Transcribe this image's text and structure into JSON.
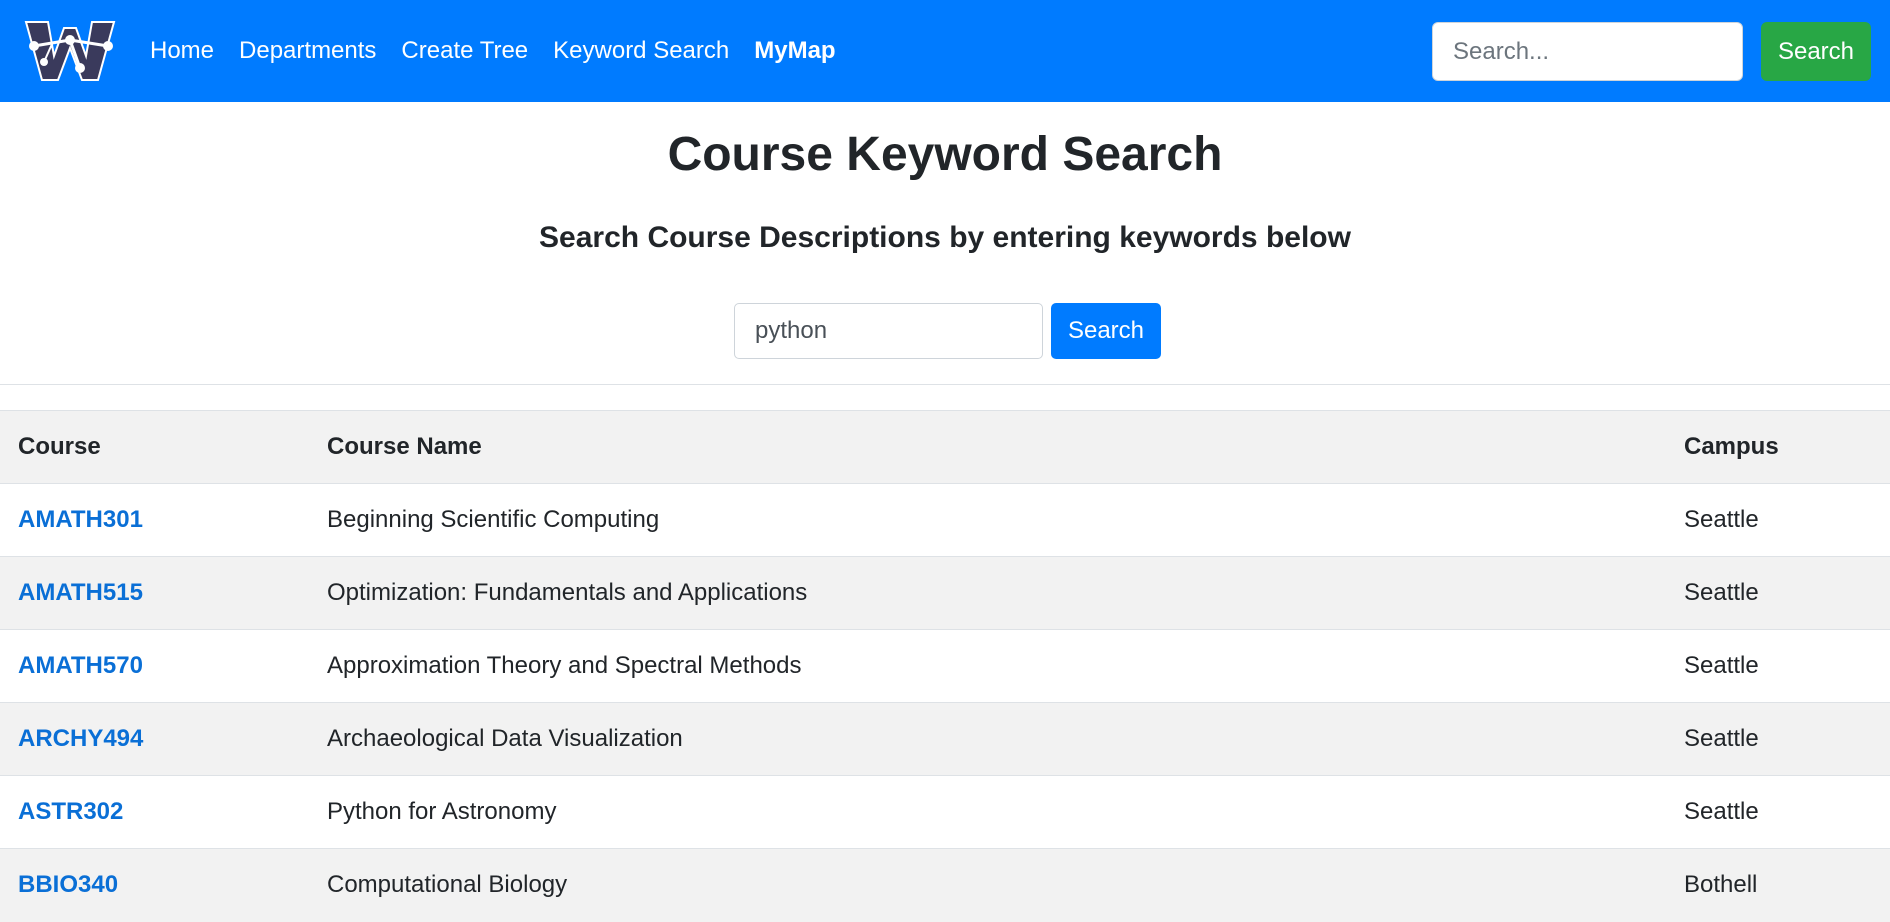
{
  "navbar": {
    "logo_icon": "uw-w-tree-logo",
    "links": [
      {
        "label": "Home",
        "active": false
      },
      {
        "label": "Departments",
        "active": false
      },
      {
        "label": "Create Tree",
        "active": false
      },
      {
        "label": "Keyword Search",
        "active": false
      },
      {
        "label": "MyMap",
        "active": true
      }
    ],
    "search": {
      "placeholder": "Search...",
      "value": "",
      "button_label": "Search"
    },
    "colors": {
      "background": "#007bff",
      "search_button": "#28a745"
    }
  },
  "main": {
    "title": "Course Keyword Search",
    "subtitle": "Search Course Descriptions by entering keywords below",
    "keyword_input": {
      "value": "python",
      "placeholder": ""
    },
    "search_button_label": "Search"
  },
  "table": {
    "headers": {
      "course": "Course",
      "name": "Course Name",
      "campus": "Campus"
    },
    "rows": [
      {
        "course": "AMATH301",
        "name": "Beginning Scientific Computing",
        "campus": "Seattle"
      },
      {
        "course": "AMATH515",
        "name": "Optimization: Fundamentals and Applications",
        "campus": "Seattle"
      },
      {
        "course": "AMATH570",
        "name": "Approximation Theory and Spectral Methods",
        "campus": "Seattle"
      },
      {
        "course": "ARCHY494",
        "name": "Archaeological Data Visualization",
        "campus": "Seattle"
      },
      {
        "course": "ASTR302",
        "name": "Python for Astronomy",
        "campus": "Seattle"
      },
      {
        "course": "BBIO340",
        "name": "Computational Biology",
        "campus": "Bothell"
      }
    ]
  }
}
